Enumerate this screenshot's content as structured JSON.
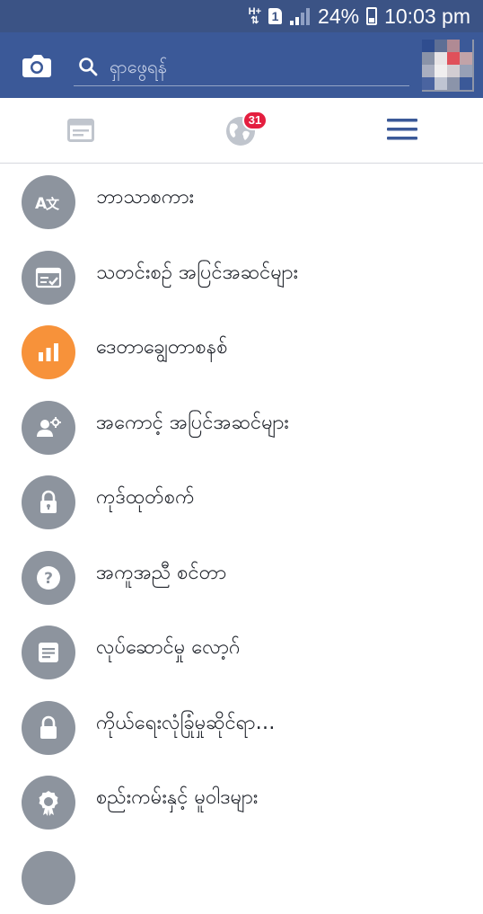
{
  "status_bar": {
    "network": "H+",
    "sim": "1",
    "battery": "24%",
    "time": "10:03 pm"
  },
  "header": {
    "camera_icon": "camera-icon",
    "search": {
      "placeholder": "ရှာဖွေရန်",
      "value": ""
    },
    "avatar": "profile-avatar"
  },
  "tabs": {
    "news_feed_icon": "news-feed-icon",
    "notifications_icon": "globe-icon",
    "notifications_count": "31",
    "menu_icon": "hamburger-menu-icon",
    "active_color": "#3b5998",
    "inactive_color": "#c0c5cd"
  },
  "menu": {
    "items": [
      {
        "label": "ဘာသာစကား",
        "icon": "language-icon",
        "color": "#8d949e"
      },
      {
        "label": "သတင်းစဉ် အပြင်အဆင်များ",
        "icon": "news-feed-settings-icon",
        "color": "#8d949e"
      },
      {
        "label": "ဒေတာချွေတာစနစ်",
        "icon": "data-saver-icon",
        "color": "#f7923a"
      },
      {
        "label": "အကောင့် အပြင်အဆင်များ",
        "icon": "account-settings-icon",
        "color": "#8d949e"
      },
      {
        "label": "ကုဒ်ထုတ်စက်",
        "icon": "code-generator-icon",
        "color": "#8d949e"
      },
      {
        "label": "အကူအညီ စင်တာ",
        "icon": "help-center-icon",
        "color": "#8d949e"
      },
      {
        "label": "လုပ်ဆောင်မှု လော့ဂ်",
        "icon": "activity-log-icon",
        "color": "#8d949e"
      },
      {
        "label": "ကိုယ်ရေးလုံခြုံမှုဆိုင်ရာ…",
        "icon": "privacy-shortcuts-icon",
        "color": "#8d949e"
      },
      {
        "label": "စည်းကမ်းနှင့် မူဝါဒများ",
        "icon": "terms-policies-icon",
        "color": "#8d949e"
      },
      {
        "label": "",
        "icon": "more-icon",
        "color": "#8d949e"
      }
    ]
  }
}
